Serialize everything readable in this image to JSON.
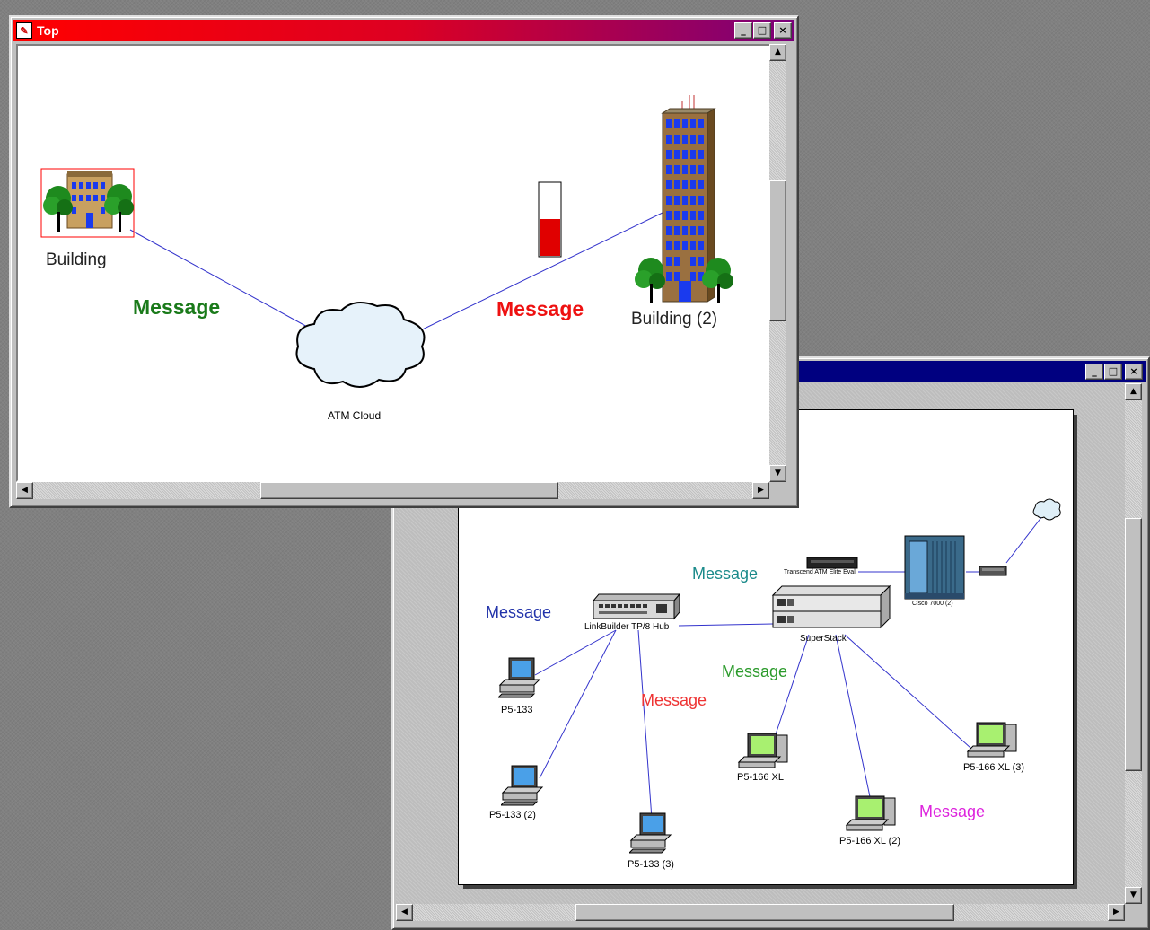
{
  "top_window": {
    "title": "Top",
    "buttons": {
      "minimize": "_",
      "maximize": "□",
      "close": "×"
    },
    "nodes": {
      "building": "Building",
      "building2": "Building (2)",
      "atm_cloud": "ATM Cloud"
    },
    "messages": {
      "left": "Message",
      "right": "Message"
    },
    "gauge_level": 0.5,
    "colors": {
      "title_start": "#ff0000",
      "title_end": "#7a007a",
      "msg_left": "#1a7a1a",
      "msg_right": "#ee1111",
      "link": "#3333cc"
    }
  },
  "bottom_window": {
    "title": "",
    "buttons": {
      "minimize": "_",
      "maximize": "□",
      "close": "×"
    },
    "devices": {
      "hub": "LinkBuilder TP/8 Hub",
      "superstack": "SuperStack",
      "transceiver": "Transcend ATM Elite Eval",
      "cisco": "Cisco 7000 (2)",
      "pc1": "P5-133",
      "pc2": "P5-133 (2)",
      "pc3": "P5-133 (3)",
      "pc4": "P5-166 XL",
      "pc5": "P5-166 XL (2)",
      "pc6": "P5-166 XL (3)"
    },
    "messages": {
      "m_hub": "Message",
      "m_teal": "Message",
      "m_red": "Message",
      "m_green": "Message",
      "m_magenta": "Message"
    },
    "colors": {
      "title": "#000080",
      "m_hub": "#2233aa",
      "m_teal": "#1a8a8a",
      "m_red": "#ee3333",
      "m_green": "#2a9a2a",
      "m_magenta": "#dd22dd",
      "link": "#3333cc"
    }
  },
  "scroll_arrows": {
    "up": "▲",
    "down": "▼",
    "left": "◀",
    "right": "▶"
  }
}
